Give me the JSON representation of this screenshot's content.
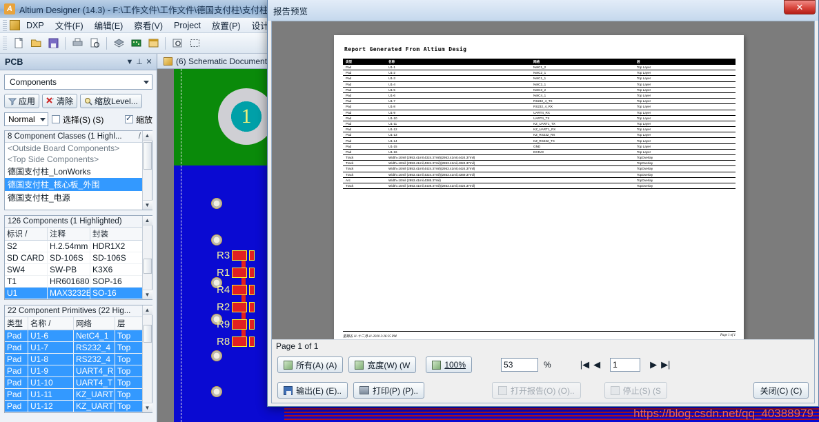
{
  "app": {
    "title": "Altium Designer (14.3) - F:\\工作文件\\工作文件\\德国支付柱\\支付柱",
    "logo": "A",
    "menus": [
      "DXP",
      "文件(F)",
      "编辑(E)",
      "察看(V)",
      "Project",
      "放置(P)",
      "设计(D)"
    ]
  },
  "pcb_panel": {
    "title": "PCB",
    "header_icons": {
      "dropdown": "▼",
      "pin": "⊥",
      "close": "✕"
    },
    "scope_combo": "Components",
    "buttons": [
      {
        "label": "应用",
        "icon": "filter-icon"
      },
      {
        "label": "清除",
        "icon": "clear-icon"
      },
      {
        "label": "缩放Level...",
        "icon": "zoom-icon"
      }
    ],
    "mode_combo": "Normal",
    "select_checkbox": {
      "label": "选择(S) (S)",
      "checked": false
    },
    "zoom_checkbox": {
      "label": "缩放",
      "checked": true
    },
    "classes_list": {
      "caption": "8 Component Classes (1 Highl...",
      "sortmark": "/",
      "items": [
        {
          "text": "<Outside Board Components>",
          "style": "dim"
        },
        {
          "text": "<Top Side Components>",
          "style": "dim"
        },
        {
          "text": "德国支付柱_LonWorks",
          "style": "normal"
        },
        {
          "text": "德国支付柱_核心板_外围",
          "style": "selected"
        },
        {
          "text": "德国支付柱_电源",
          "style": "normal"
        }
      ]
    },
    "components_table": {
      "caption": "126 Components (1 Highlighted)",
      "columns": [
        "标识  /",
        "注释",
        "封装"
      ],
      "rows": [
        {
          "cells": [
            "S2",
            "H.2.54mm",
            "HDR1X2"
          ],
          "selected": false
        },
        {
          "cells": [
            "SD CARD",
            "SD-106S",
            "SD-106S"
          ],
          "selected": false
        },
        {
          "cells": [
            "SW4",
            "SW-PB",
            "K3X6"
          ],
          "selected": false
        },
        {
          "cells": [
            "T1",
            "HR601680",
            "SOP-16"
          ],
          "selected": false
        },
        {
          "cells": [
            "U1",
            "MAX3232E",
            "SO-16"
          ],
          "selected": true
        }
      ]
    },
    "primitives_table": {
      "caption": "22 Component Primitives (22 Hig...",
      "columns": [
        "类型",
        "名称        /",
        "网络",
        "层"
      ],
      "rows": [
        {
          "cells": [
            "Pad",
            "U1-6",
            "NetC4_1",
            "Top"
          ],
          "selected": true
        },
        {
          "cells": [
            "Pad",
            "U1-7",
            "RS232_4",
            "Top"
          ],
          "selected": true
        },
        {
          "cells": [
            "Pad",
            "U1-8",
            "RS232_4",
            "Top"
          ],
          "selected": true
        },
        {
          "cells": [
            "Pad",
            "U1-9",
            "UART4_R",
            "Top"
          ],
          "selected": true
        },
        {
          "cells": [
            "Pad",
            "U1-10",
            "UART4_T",
            "Top"
          ],
          "selected": true
        },
        {
          "cells": [
            "Pad",
            "U1-11",
            "KZ_UART",
            "Top"
          ],
          "selected": true
        },
        {
          "cells": [
            "Pad",
            "U1-12",
            "KZ_UART",
            "Top"
          ],
          "selected": true
        }
      ]
    }
  },
  "editor": {
    "tab_label": "(6) Schematic Document",
    "big_pad_number": "1",
    "designators": [
      "R3",
      "R1",
      "R4",
      "R2",
      "R9",
      "R8"
    ]
  },
  "dialog": {
    "title": "报告预览",
    "close_glyph": "✕",
    "page_status": "Page 1 of 1",
    "zoom_value": "53",
    "zoom_unit": "%",
    "page_value": "1",
    "zoom_buttons": [
      {
        "label": "所有(A) (A)",
        "icon": "fit-page-icon",
        "disabled": false
      },
      {
        "label": "宽度(W) (W",
        "icon": "fit-width-icon",
        "disabled": false
      },
      {
        "label": "100%",
        "icon": "actual-size-icon",
        "disabled": false
      }
    ],
    "nav": {
      "first": "|◀",
      "prev": "◀",
      "next": "▶",
      "last": "▶|"
    },
    "action_buttons": [
      {
        "label": "输出(E) (E)..",
        "icon": "export-icon",
        "disabled": false
      },
      {
        "label": "打印(P) (P)..",
        "icon": "print-icon",
        "disabled": false
      },
      {
        "label": "打开报告(O) (O)..",
        "icon": "open-report-icon",
        "disabled": true
      },
      {
        "label": "停止(S) (S",
        "icon": "stop-icon",
        "disabled": true
      }
    ],
    "close_button": "关闭(C) (C)"
  },
  "report": {
    "heading": "Report Generated From Altium Desig",
    "columns": [
      "类型",
      "名称",
      "网络",
      "层"
    ],
    "rows": [
      [
        "Pad",
        "U1-1",
        "NetC1_2",
        "Top Layer"
      ],
      [
        "Pad",
        "U1-2",
        "NetC2_1",
        "Top Layer"
      ],
      [
        "Pad",
        "U1-3",
        "NetC1_1",
        "Top Layer"
      ],
      [
        "Pad",
        "U1-4",
        "NetC2_1",
        "Top Layer"
      ],
      [
        "Pad",
        "U1-5",
        "NetC3_2",
        "Top Layer"
      ],
      [
        "Pad",
        "U1-6",
        "NetC4_1",
        "Top Layer"
      ],
      [
        "Pad",
        "U1-7",
        "RS232_4_TX",
        "Top Layer"
      ],
      [
        "Pad",
        "U1-8",
        "RS232_4_RX",
        "Top Layer"
      ],
      [
        "Pad",
        "U1-9",
        "UART4_RX",
        "Top Layer"
      ],
      [
        "Pad",
        "U1-10",
        "UART4_TX",
        "Top Layer"
      ],
      [
        "Pad",
        "U1-11",
        "KZ_UART1_TX",
        "Top Layer"
      ],
      [
        "Pad",
        "U1-12",
        "KZ_UART1_RX",
        "Top Layer"
      ],
      [
        "Pad",
        "U1-13",
        "KZ_RS232_RX",
        "Top Layer"
      ],
      [
        "Pad",
        "U1-14",
        "KZ_RS232_TX",
        "Top Layer"
      ],
      [
        "Pad",
        "U1-15",
        "GND",
        "Top Layer"
      ],
      [
        "Pad",
        "U1-16",
        "DC5V3",
        "Top Layer"
      ],
      [
        "Track",
        "Width=10mil (2953.41mil,4324.37mil)(2953.41mil,4424.37mil)",
        "",
        "TopOverlay"
      ],
      [
        "Track",
        "Width=10mil (2953.41mil,4324.37mil)(2853.41mil,4324.37mil)",
        "",
        "TopOverlay"
      ],
      [
        "Track",
        "Width=10mil (2853.41mil,4424.37mil)(2953.41mil,4424.37mil)",
        "",
        "TopOverlay"
      ],
      [
        "Track",
        "Width=10mil (2853.41mil,4324.37mil)(2853.41mil,4369.37mil)",
        "",
        "TopOverlay"
      ],
      [
        "Arc",
        "Width=10mil (2953.41mil,4385.37mil)",
        "",
        "TopOverlay"
      ],
      [
        "Track",
        "Width=10mil (2853.41mil,4439.37mil)(2853.41mil,4424.37mil)",
        "",
        "TopOverlay"
      ]
    ],
    "footer_left": "星期五 11-十二月-11-2020   3:26:25 PM",
    "footer_right": "Page 1 of 1"
  },
  "watermark": "https://blog.csdn.net/qq_40388979"
}
